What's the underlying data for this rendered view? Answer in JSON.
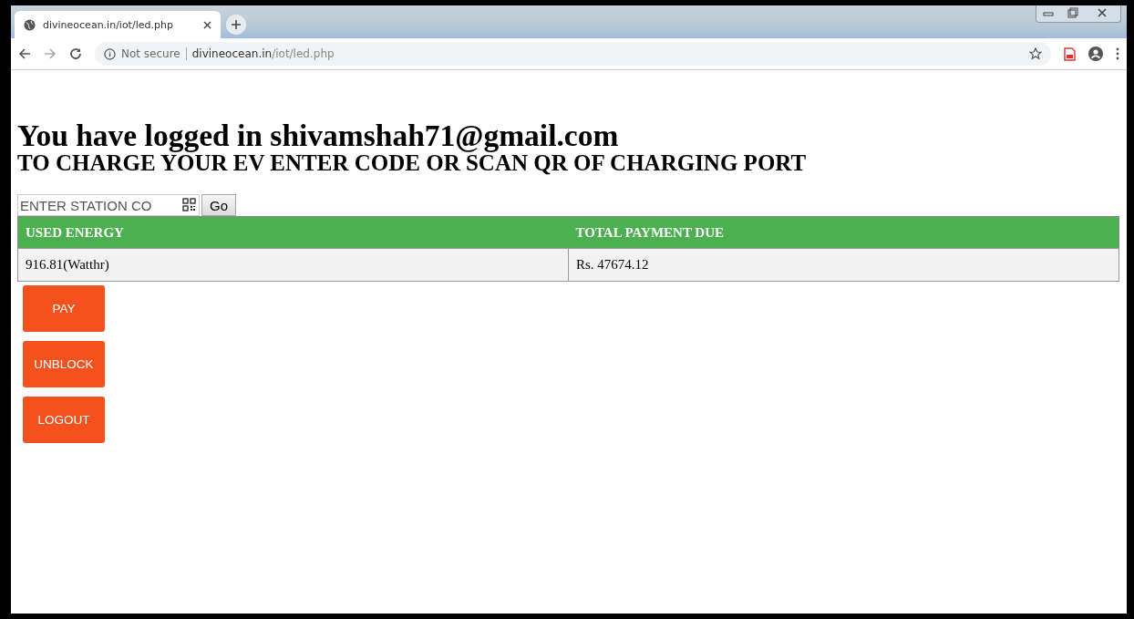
{
  "browser": {
    "tab": {
      "title": "divineocean.in/iot/led.php",
      "selected": true
    },
    "address": {
      "security": "Not secure",
      "host": "divineocean.in",
      "path": "/iot/led.php"
    }
  },
  "page": {
    "heading": "You have logged in shivamshah71@gmail.com",
    "subheading": "TO CHARGE YOUR EV ENTER CODE OR SCAN QR OF CHARGING PORT",
    "station_field": {
      "placeholder": "ENTER STATION CO"
    },
    "go_button": "Go",
    "table": {
      "columns": [
        "USED ENERGY",
        "TOTAL PAYMENT DUE"
      ],
      "rows": [
        [
          "916.81(Watthr)",
          "Rs. 47674.12"
        ]
      ]
    },
    "buttons": [
      "PAY",
      "UNBLOCK",
      "LOGOUT"
    ]
  }
}
